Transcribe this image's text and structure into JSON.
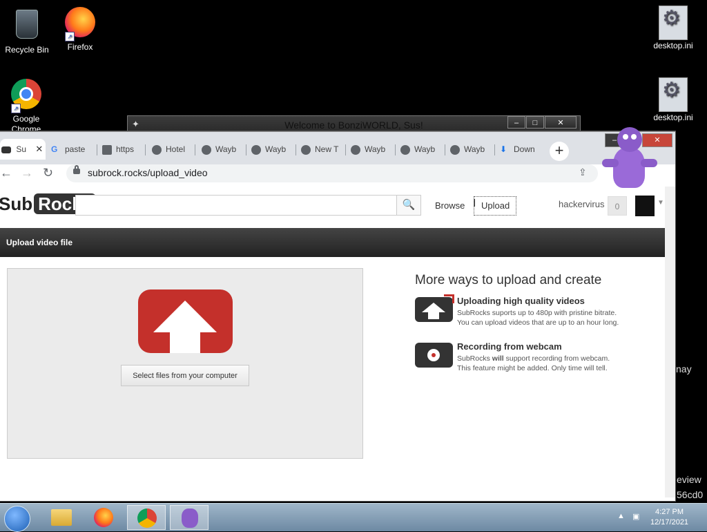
{
  "desktop": {
    "icons": [
      {
        "label": "Recycle Bin",
        "icon": "recycle-bin-icon"
      },
      {
        "label": "Firefox",
        "icon": "firefox-icon"
      },
      {
        "label": "Google Chrome",
        "icon": "chrome-icon"
      },
      {
        "label": "desktop.ini",
        "icon": "settings-file-icon"
      },
      {
        "label": "desktop.ini",
        "icon": "settings-file-icon"
      }
    ],
    "fragments": [
      "nay",
      "eview",
      "56cd0"
    ]
  },
  "bonzi_window": {
    "title": "Welcome to BonziWORLD, Sus!",
    "buttons": [
      "–",
      "□",
      "✕"
    ]
  },
  "browser": {
    "tabs": [
      {
        "label": "Su",
        "active": true
      },
      {
        "label": "paste"
      },
      {
        "label": "https"
      },
      {
        "label": "Hotel"
      },
      {
        "label": "Wayb"
      },
      {
        "label": "Wayb"
      },
      {
        "label": "New T"
      },
      {
        "label": "Wayb"
      },
      {
        "label": "Wayb"
      },
      {
        "label": "Wayb"
      },
      {
        "label": "Down"
      }
    ],
    "new_tab": "+",
    "url": "subrock.rocks/upload_video",
    "window_buttons": [
      "–",
      "✕"
    ]
  },
  "site": {
    "logo_left": "Sub",
    "logo_right": "Rocks",
    "search_placeholder": "",
    "browse": "Browse",
    "upload": "Upload",
    "username": "hackervirus",
    "count": "0",
    "section_title": "Upload video file",
    "select_button": "Select files from your computer",
    "more_title": "More ways to upload and create",
    "features": [
      {
        "title": "Uploading high quality videos",
        "desc_1": "SubRocks suports up to 480p with pristine bitrate.",
        "desc_2": "You can upload videos that are up to an hour long."
      },
      {
        "title": "Recording from webcam",
        "desc_1_a": "SubRocks ",
        "desc_1_b": "will",
        "desc_1_c": " support recording from webcam.",
        "desc_2": "This feature might be added. Only time will tell."
      }
    ],
    "accent": "#c4302b"
  },
  "taskbar": {
    "time": "4:27 PM",
    "date": "12/17/2021"
  }
}
